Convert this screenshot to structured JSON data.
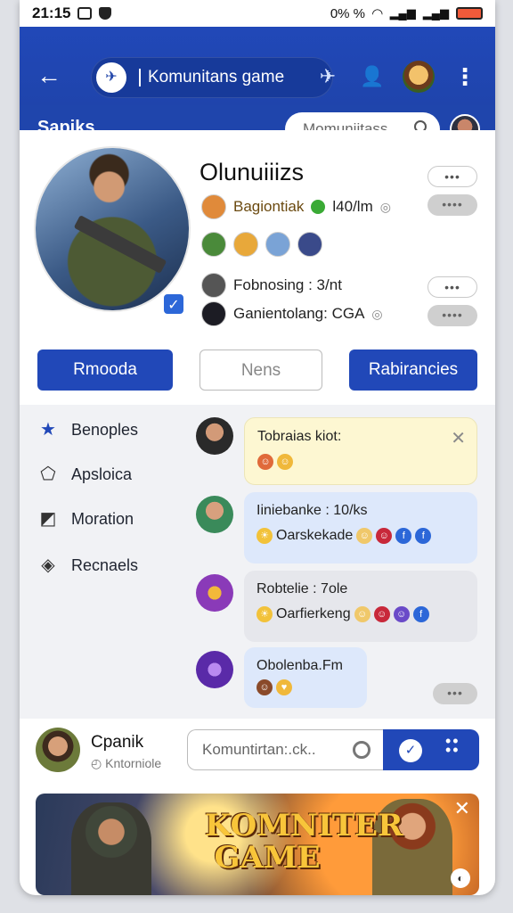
{
  "status_bar": {
    "time": "21:15",
    "right_text": "0% %"
  },
  "app_bar": {
    "community_title": "Komunitans game",
    "page_title": "Sapiks",
    "search_placeholder": "Momuniitass"
  },
  "profile": {
    "name": "Olunuiiizs",
    "rows": [
      {
        "name": "Bagiontiak",
        "meta": "l40/lm"
      },
      {
        "name": "Fobnosing : 3/nt"
      },
      {
        "name": "Ganientolang: CGA"
      }
    ],
    "pill_dots": "•••",
    "pill_dots2": "••••"
  },
  "actions": {
    "left": "Rmooda",
    "middle": "Nens",
    "right": "Rabirancies"
  },
  "sidebar": {
    "items": [
      {
        "label": "Benoples"
      },
      {
        "label": "Apsloica"
      },
      {
        "label": "Moration"
      },
      {
        "label": "Recnaels"
      }
    ]
  },
  "messages": [
    {
      "title": "Tobraias kiot:"
    },
    {
      "title": "Iiniebanke : 10/ks",
      "line2": "Oarskekade"
    },
    {
      "title": "Robtelie : 7ole",
      "line2": "Oarfierkeng"
    },
    {
      "title": "Obolenba.Fm"
    }
  ],
  "more_dots": "•••",
  "composer": {
    "name": "Cpanik",
    "sub": "Kntorniole",
    "placeholder": "Komuntirtan:.ck.."
  },
  "banner": {
    "title": "KOMNITER GAME"
  },
  "colors": {
    "primary": "#2148b8",
    "background": "#f1f2f5"
  }
}
